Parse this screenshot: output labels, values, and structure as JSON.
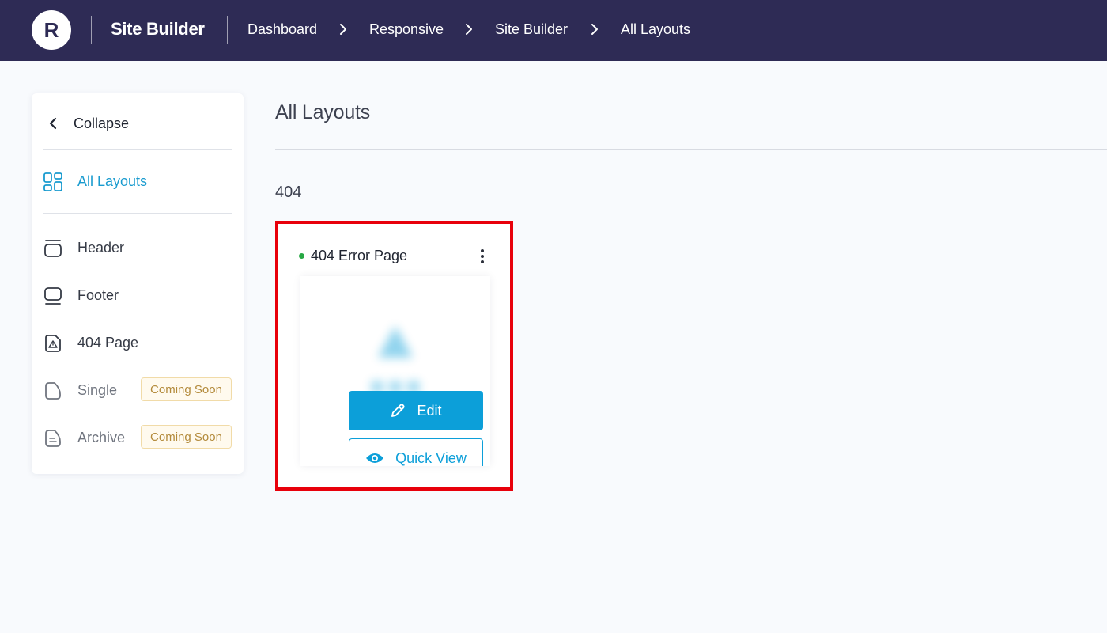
{
  "header": {
    "logo_letter": "R",
    "app_name": "Site Builder",
    "breadcrumbs": [
      "Dashboard",
      "Responsive",
      "Site Builder",
      "All Layouts"
    ],
    "background_color": "#2e2b55"
  },
  "sidebar": {
    "collapse_label": "Collapse",
    "items": [
      {
        "label": "All Layouts",
        "icon": "grid-icon",
        "active": true
      },
      {
        "label": "Header",
        "icon": "header-icon"
      },
      {
        "label": "Footer",
        "icon": "footer-icon"
      },
      {
        "label": "404 Page",
        "icon": "warning-page-icon"
      },
      {
        "label": "Single",
        "icon": "single-page-icon",
        "badge": "Coming Soon"
      },
      {
        "label": "Archive",
        "icon": "archive-page-icon",
        "badge": "Coming Soon"
      }
    ]
  },
  "main": {
    "title": "All Layouts",
    "section_label": "404",
    "card": {
      "title": "404 Error Page",
      "status_color": "#27a844",
      "edit_label": "Edit",
      "quick_view_label": "Quick View",
      "highlight_color": "#e8000b"
    }
  },
  "colors": {
    "accent": "#0c9fd9",
    "badge_text": "#b38a3a",
    "badge_bg": "#fffaee"
  }
}
